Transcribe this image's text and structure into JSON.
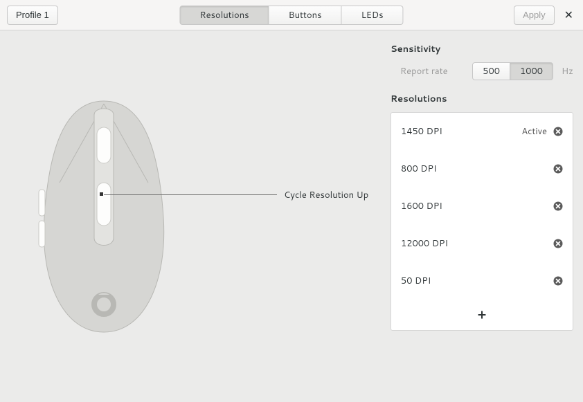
{
  "toolbar": {
    "profile_label": "Profile 1",
    "tabs": [
      {
        "label": "Resolutions",
        "active": true
      },
      {
        "label": "Buttons",
        "active": false
      },
      {
        "label": "LEDs",
        "active": false
      }
    ],
    "apply_label": "Apply",
    "apply_disabled": true,
    "close_glyph": "✕"
  },
  "mouse": {
    "callout_label": "Cycle Resolution Up"
  },
  "sensitivity": {
    "heading": "Sensitivity",
    "rate_label": "Report rate",
    "rates": [
      {
        "label": "500",
        "active": false
      },
      {
        "label": "1000",
        "active": true
      }
    ],
    "unit": "Hz"
  },
  "resolutions": {
    "heading": "Resolutions",
    "active_label": "Active",
    "add_glyph": "+",
    "items": [
      {
        "label": "1450 DPI",
        "active": true
      },
      {
        "label": "800 DPI",
        "active": false
      },
      {
        "label": "1600 DPI",
        "active": false
      },
      {
        "label": "12000 DPI",
        "active": false
      },
      {
        "label": "50 DPI",
        "active": false
      }
    ]
  }
}
